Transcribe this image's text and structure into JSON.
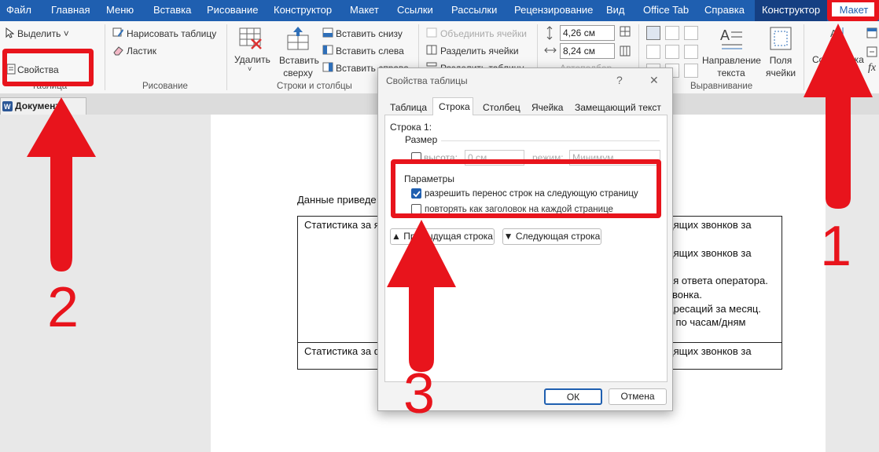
{
  "tabs": [
    "Файл",
    "Главная",
    "Меню",
    "Вставка",
    "Рисование",
    "Конструктор",
    "Макет",
    "Ссылки",
    "Рассылки",
    "Рецензирование",
    "Вид",
    "Office Tab",
    "Справка",
    "Конструктор",
    "Макет"
  ],
  "ribbon": {
    "select": "Выделить",
    "properties": "Свойства",
    "group_table": "Таблица",
    "draw_table": "Нарисовать таблицу",
    "eraser": "Ластик",
    "group_draw": "Рисование",
    "delete": "Удалить",
    "insert_above": [
      "Вставить",
      "сверху"
    ],
    "insert_below": "Вставить снизу",
    "insert_left": "Вставить слева",
    "insert_right": "Вставить справа",
    "group_rows_cols": "Строки и столбцы",
    "merge_cells": "Объединить ячейки",
    "split_cells": "Разделить ячейки",
    "split_table": "Разделить таблицу",
    "height_value": "4,26 см",
    "width_value": "8,24 см",
    "autofit": "Автоподбор",
    "text_direction": [
      "Направление",
      "текста"
    ],
    "cell_margins": [
      "Поля",
      "ячейки"
    ],
    "group_align": "Выравнивание",
    "sort": "Сортировка",
    "fx": "fx"
  },
  "doc_tab": "Документ",
  "document": {
    "intro": "Данные приведе",
    "cell1_left": "Статистика за я",
    "cell1_right": [
      "дящих звонков за",
      "",
      "дящих звонков за",
      "",
      "ия ответа оператора.",
      "звонка.",
      "дресаций за месяц.",
      "в по часам/дням"
    ],
    "cell2_left": "Статистика за ф",
    "cell2_right": "дящих звонков за"
  },
  "dialog": {
    "title": "Свойства таблицы",
    "help": "?",
    "close": "✕",
    "tabs": [
      "Таблица",
      "Строка",
      "Столбец",
      "Ячейка",
      "Замещающий текст"
    ],
    "row_label": "Строка 1:",
    "size_label": "Размер",
    "height_label": "высота:",
    "height_value": "0 см",
    "mode_label": "режим:",
    "mode_value": "Минимум",
    "params_label": "Параметры",
    "allow_break": "разрешить перенос строк на следующую страницу",
    "repeat_header": "повторять как заголовок на каждой странице",
    "prev_row": "Предыдущая строка",
    "next_row": "Следующая строка",
    "ok": "ОК",
    "cancel": "Отмена"
  },
  "annotations": {
    "n1": "1",
    "n2": "2",
    "n3": "3"
  },
  "colors": {
    "titlebar": "#1f5fb0",
    "annotation": "#e8141c"
  }
}
